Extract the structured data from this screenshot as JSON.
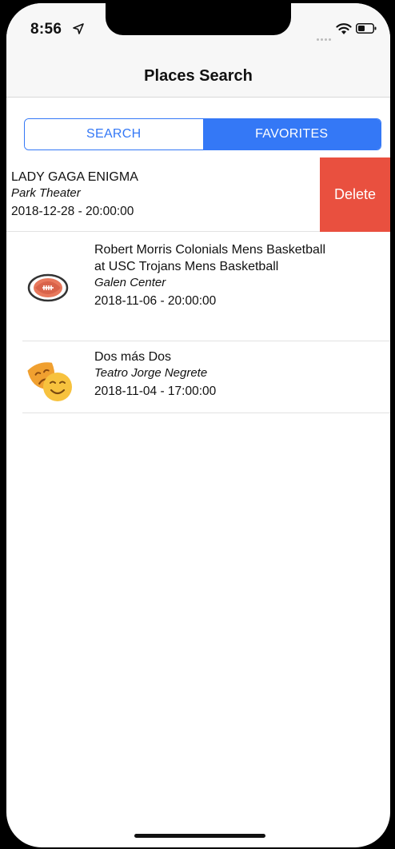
{
  "status_bar": {
    "time": "8:56",
    "icons": [
      "location-arrow-icon",
      "wifi-icon",
      "battery-icon"
    ]
  },
  "nav": {
    "title": "Places Search"
  },
  "segments": {
    "search_label": "SEARCH",
    "favorites_label": "FAVORITES",
    "selected": "FAVORITES"
  },
  "favorites": [
    {
      "title": "LADY GAGA ENIGMA",
      "venue": "Park Theater",
      "datetime": "2018-12-28 - 20:00:00",
      "icon": "none",
      "swipe_action_label": "Delete"
    },
    {
      "title": "Robert Morris Colonials Mens Basketball at USC Trojans Mens Basketball",
      "venue": "Galen Center",
      "datetime": "2018-11-06 - 20:00:00",
      "icon": "football-icon"
    },
    {
      "title": "Dos más Dos",
      "venue": "Teatro Jorge Negrete",
      "datetime": "2018-11-04 - 17:00:00",
      "icon": "theater-masks-icon"
    }
  ],
  "colors": {
    "accent": "#3478f6",
    "delete": "#e9503f"
  }
}
